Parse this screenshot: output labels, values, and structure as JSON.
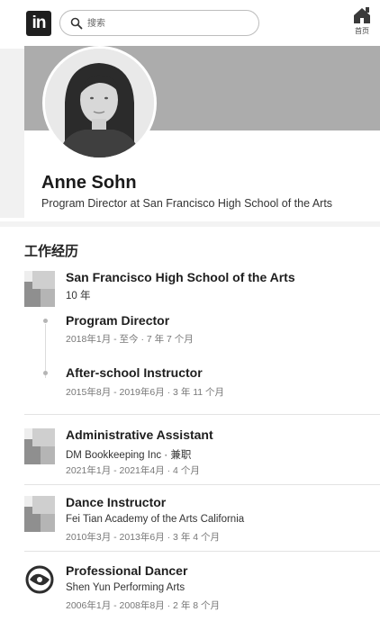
{
  "header": {
    "logo_text": "in",
    "search_placeholder": "搜索",
    "home_label": "首页"
  },
  "profile": {
    "name": "Anne Sohn",
    "headline": "Program Director at San Francisco High School of the Arts"
  },
  "experience": {
    "title": "工作经历",
    "group": {
      "company": "San Francisco High School of the Arts",
      "duration": "10 年",
      "roles": [
        {
          "title": "Program Director",
          "dates": "2018年1月 - 至今 · 7 年 7 个月"
        },
        {
          "title": "After-school Instructor",
          "dates": "2015年8月 - 2019年6月 · 3 年 11 个月"
        }
      ]
    },
    "items": [
      {
        "title": "Administrative Assistant",
        "company": "DM Bookkeeping Inc · 兼职",
        "dates": "2021年1月 - 2021年4月 · 4 个月"
      },
      {
        "title": "Dance Instructor",
        "company": "Fei Tian Academy of the Arts California",
        "dates": "2010年3月 - 2013年6月 · 3 年 4 个月"
      },
      {
        "title": "Professional Dancer",
        "company": "Shen Yun Performing Arts",
        "dates": "2006年1月 - 2008年8月 · 2 年 8 个月"
      }
    ]
  }
}
